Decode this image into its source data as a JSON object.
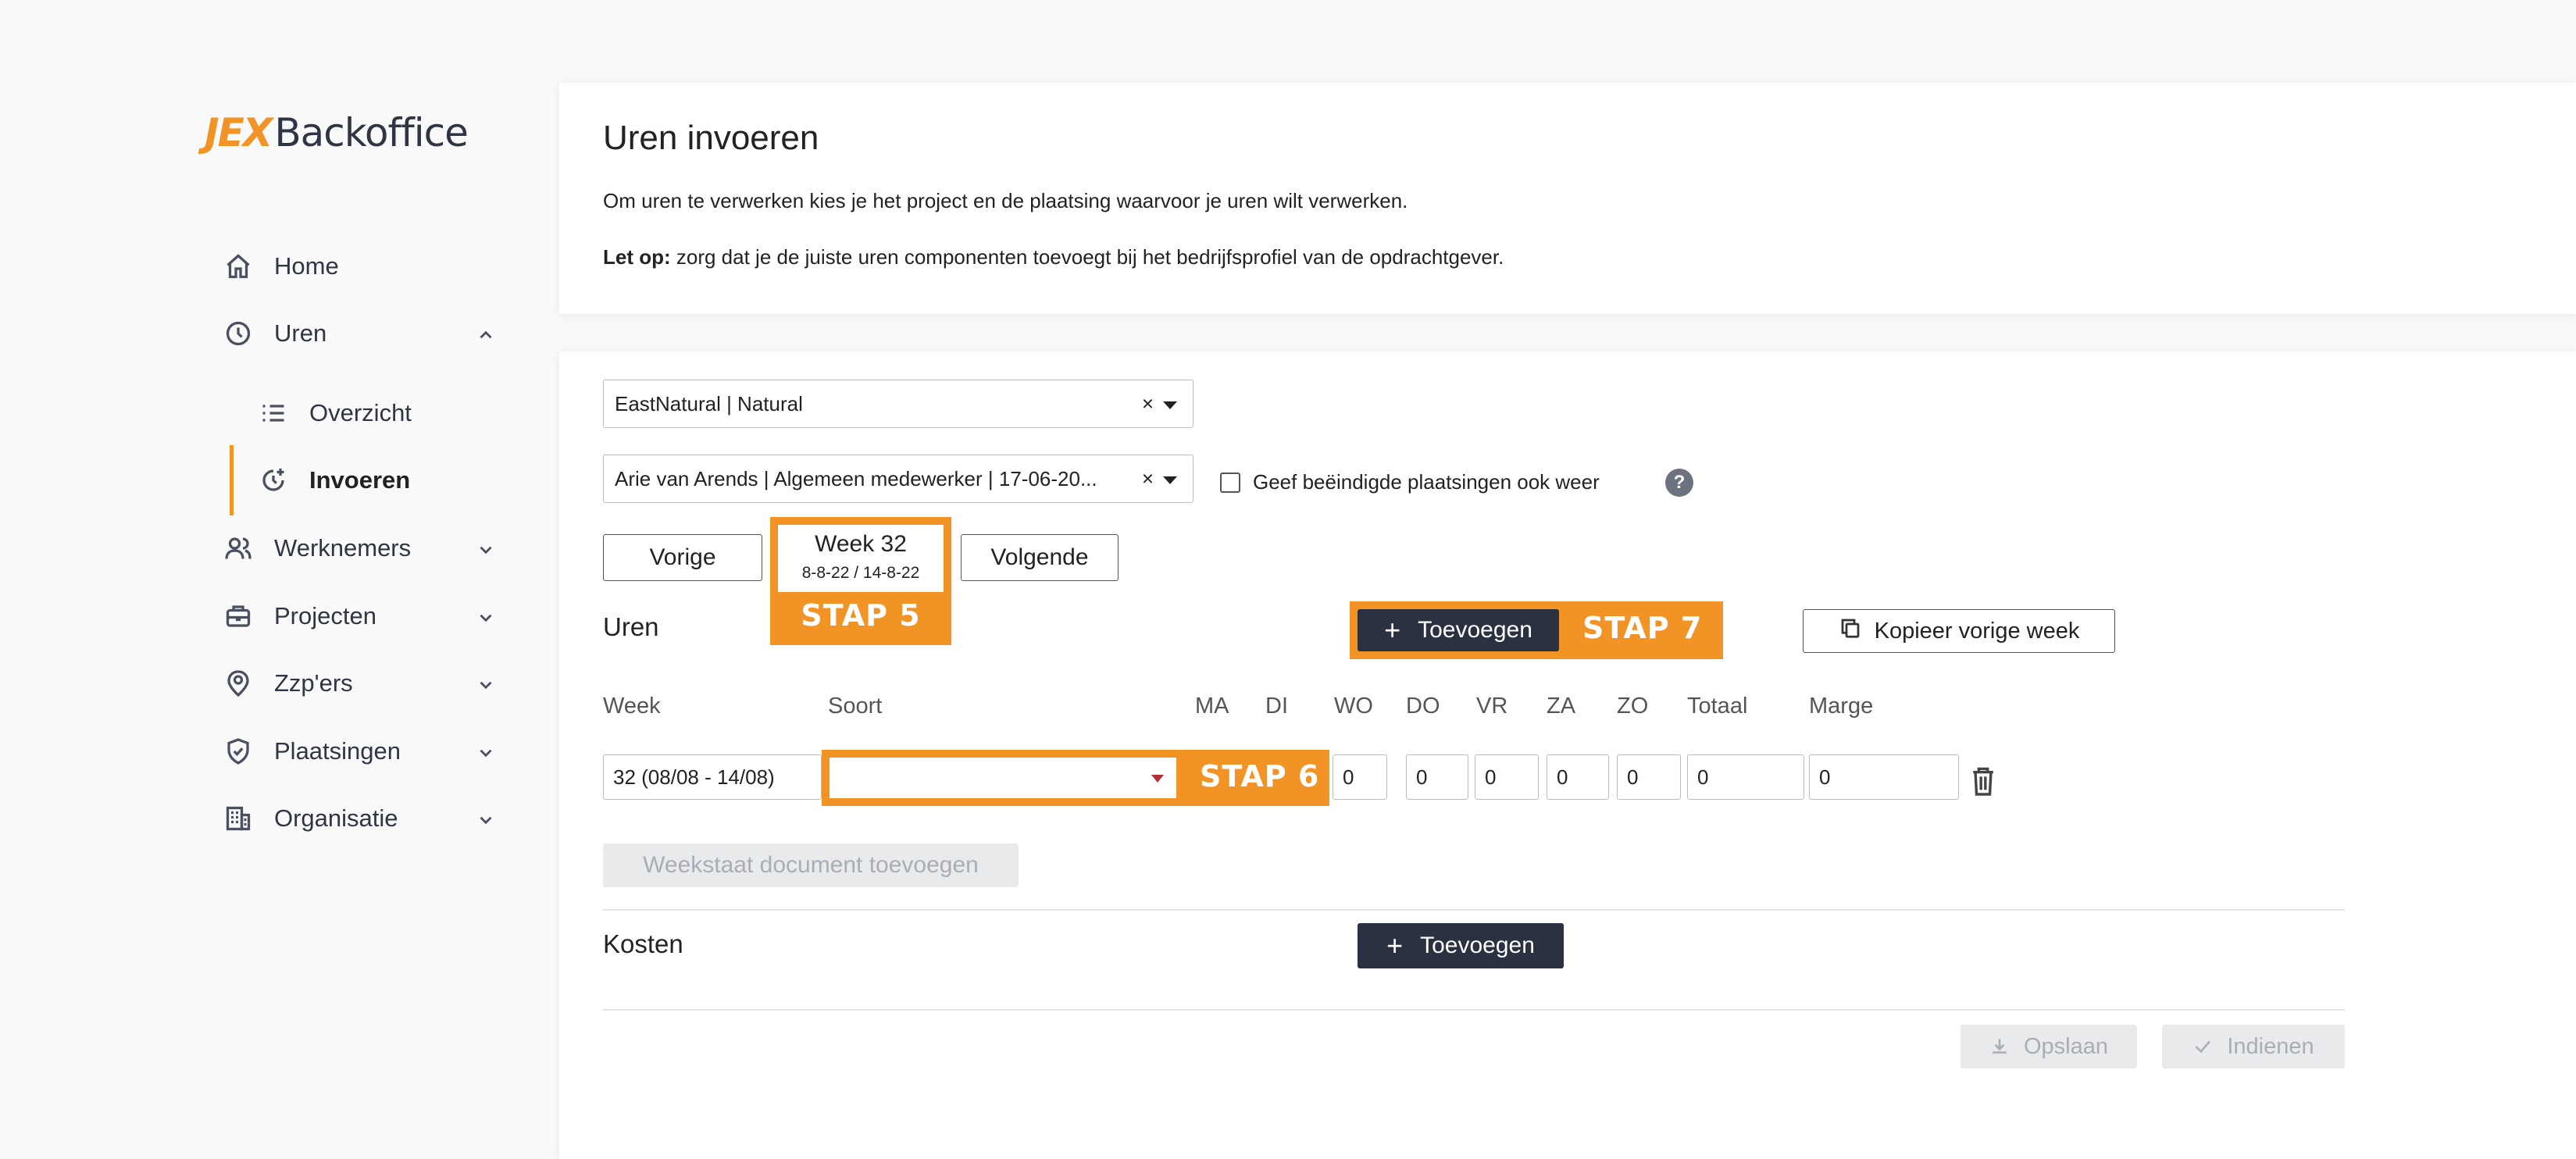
{
  "brand": {
    "logo_mark": "JEX",
    "logo_text": "Backoffice"
  },
  "sidebar": {
    "items": [
      {
        "label": "Home",
        "icon": "home-icon"
      },
      {
        "label": "Uren",
        "icon": "clock-icon"
      },
      {
        "label": "Overzicht",
        "icon": "list-icon"
      },
      {
        "label": "Invoeren",
        "icon": "clock-plus-icon"
      },
      {
        "label": "Werknemers",
        "icon": "users-icon"
      },
      {
        "label": "Projecten",
        "icon": "briefcase-icon"
      },
      {
        "label": "Zzp'ers",
        "icon": "badge-icon"
      },
      {
        "label": "Plaatsingen",
        "icon": "shield-check-icon"
      },
      {
        "label": "Organisatie",
        "icon": "building-icon"
      }
    ]
  },
  "header_card": {
    "title": "Uren invoeren",
    "intro": "Om uren te verwerken kies je het project en de plaatsing waarvoor je uren wilt verwerken.",
    "note_bold": "Let op:",
    "note_text": " zorg dat je de juiste uren componenten toevoegt bij het bedrijfsprofiel van de opdrachtgever."
  },
  "form": {
    "project_select": "EastNatural | Natural",
    "placement_select": "Arie van Arends | Algemeen medewerker | 17-06-20...",
    "clear_symbol": "×",
    "show_ended_label": "Geef beëindigde plaatsingen ook weer",
    "help_symbol": "?"
  },
  "week_nav": {
    "prev_label": "Vorige",
    "next_label": "Volgende",
    "week_label": "Week 32",
    "week_range": "8-8-22 / 14-8-22",
    "stap5": "STAP 5"
  },
  "uren": {
    "section_label": "Uren",
    "copy_label": "Kopieer vorige week",
    "add_label": "Toevoegen",
    "plus": "+",
    "stap7": "STAP 7",
    "stap6": "STAP 6",
    "columns": [
      "Week",
      "Soort",
      "MA",
      "DI",
      "WO",
      "DO",
      "VR",
      "ZA",
      "ZO",
      "Totaal",
      "Marge"
    ],
    "row": {
      "week": "32 (08/08 - 14/08)",
      "soort": "",
      "wo": "0",
      "do": "0",
      "vr": "0",
      "za": "0",
      "zo": "0",
      "totaal": "0",
      "marge": "0"
    },
    "weekstaat_label": "Weekstaat document toevoegen"
  },
  "kosten": {
    "section_label": "Kosten",
    "add_label": "Toevoegen",
    "plus": "+"
  },
  "footer": {
    "save_label": "Opslaan",
    "submit_label": "Indienen"
  },
  "colors": {
    "accent": "#f29425",
    "dark_button": "#2a3140",
    "text": "#222222"
  }
}
